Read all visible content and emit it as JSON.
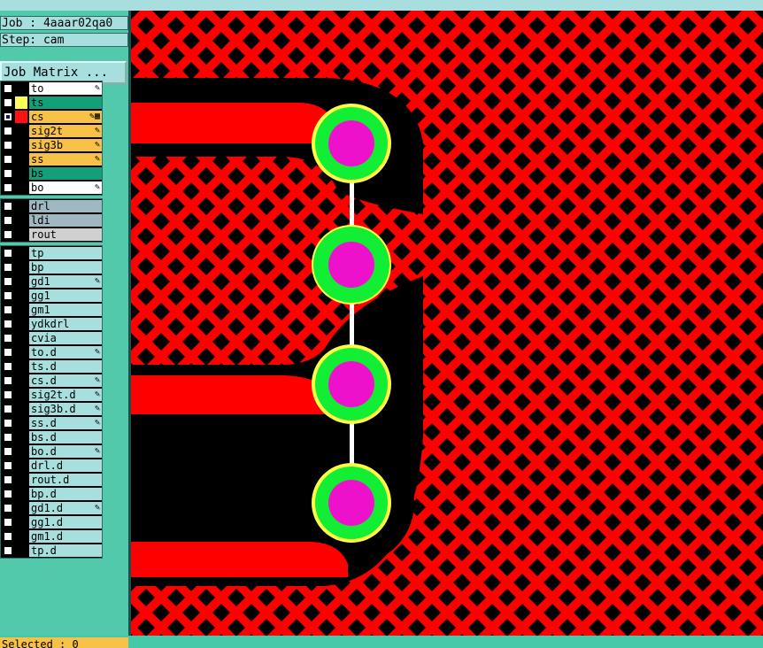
{
  "header": {
    "job": "Job : 4aaar02qa0",
    "step": "Step: cam",
    "job_matrix_label": "Job Matrix ..."
  },
  "board_layers": [
    {
      "name": "to",
      "color": "#ffffff",
      "swatch": "#000000",
      "edit": true,
      "active": false
    },
    {
      "name": "ts",
      "color": "#12a07a",
      "swatch": "#ffff55",
      "edit": false,
      "active": false
    },
    {
      "name": "cs",
      "color": "#f7c046",
      "swatch": "#ff1111",
      "edit": true,
      "active": true
    },
    {
      "name": "sig2t",
      "color": "#f7c046",
      "swatch": "#000000",
      "edit": true,
      "active": false
    },
    {
      "name": "sig3b",
      "color": "#f7c046",
      "swatch": "#000000",
      "edit": true,
      "active": false
    },
    {
      "name": "ss",
      "color": "#f7c046",
      "swatch": "#000000",
      "edit": true,
      "active": false
    },
    {
      "name": "bs",
      "color": "#12a07a",
      "swatch": "#000000",
      "edit": false,
      "active": false
    },
    {
      "name": "bo",
      "color": "#ffffff",
      "swatch": "#000000",
      "edit": true,
      "active": false
    }
  ],
  "drill_layers": [
    {
      "name": "drl",
      "color": "#9eb7c0",
      "swatch": "#000000",
      "edit": false,
      "active": false
    },
    {
      "name": "ldi",
      "color": "#9eb7c0",
      "swatch": "#000000",
      "edit": false,
      "active": false
    },
    {
      "name": "rout",
      "color": "#d0d0d0",
      "swatch": "#000000",
      "edit": false,
      "active": false
    }
  ],
  "misc_layers": [
    {
      "name": "tp",
      "color": "#a7dede",
      "swatch": "#000000",
      "edit": false,
      "active": false
    },
    {
      "name": "bp",
      "color": "#a7dede",
      "swatch": "#000000",
      "edit": false,
      "active": false
    },
    {
      "name": "gd1",
      "color": "#a7dede",
      "swatch": "#000000",
      "edit": true,
      "active": false
    },
    {
      "name": "gg1",
      "color": "#a7dede",
      "swatch": "#000000",
      "edit": false,
      "active": false
    },
    {
      "name": "gm1",
      "color": "#a7dede",
      "swatch": "#000000",
      "edit": false,
      "active": false
    },
    {
      "name": "ydkdrl",
      "color": "#a7dede",
      "swatch": "#000000",
      "edit": false,
      "active": false
    },
    {
      "name": "cvia",
      "color": "#a7dede",
      "swatch": "#000000",
      "edit": false,
      "active": false
    },
    {
      "name": "to.d",
      "color": "#a7dede",
      "swatch": "#000000",
      "edit": true,
      "active": false
    },
    {
      "name": "ts.d",
      "color": "#a7dede",
      "swatch": "#000000",
      "edit": false,
      "active": false
    },
    {
      "name": "cs.d",
      "color": "#a7dede",
      "swatch": "#000000",
      "edit": true,
      "active": false
    },
    {
      "name": "sig2t.d",
      "color": "#a7dede",
      "swatch": "#000000",
      "edit": true,
      "active": false
    },
    {
      "name": "sig3b.d",
      "color": "#a7dede",
      "swatch": "#000000",
      "edit": true,
      "active": false
    },
    {
      "name": "ss.d",
      "color": "#a7dede",
      "swatch": "#000000",
      "edit": true,
      "active": false
    },
    {
      "name": "bs.d",
      "color": "#a7dede",
      "swatch": "#000000",
      "edit": false,
      "active": false
    },
    {
      "name": "bo.d",
      "color": "#a7dede",
      "swatch": "#000000",
      "edit": true,
      "active": false
    },
    {
      "name": "drl.d",
      "color": "#a7dede",
      "swatch": "#000000",
      "edit": false,
      "active": false
    },
    {
      "name": "rout.d",
      "color": "#a7dede",
      "swatch": "#000000",
      "edit": false,
      "active": false
    },
    {
      "name": "bp.d",
      "color": "#a7dede",
      "swatch": "#000000",
      "edit": false,
      "active": false
    },
    {
      "name": "gd1.d",
      "color": "#a7dede",
      "swatch": "#000000",
      "edit": true,
      "active": false
    },
    {
      "name": "gg1.d",
      "color": "#a7dede",
      "swatch": "#000000",
      "edit": false,
      "active": false
    },
    {
      "name": "gm1.d",
      "color": "#a7dede",
      "swatch": "#000000",
      "edit": false,
      "active": false
    },
    {
      "name": "tp.d",
      "color": "#a7dede",
      "swatch": "#000000",
      "edit": false,
      "active": false
    }
  ],
  "status": {
    "selected": "Selected : 0"
  },
  "icons": {
    "edit": "pencil-icon",
    "active": "grid-icon"
  },
  "colors": {
    "copper": "#ff0000",
    "clearance": "#000000",
    "pad_outer": "#ffff44",
    "pad_ring": "#11ee33",
    "drill": "#ee11cc",
    "connector": "#ffffff"
  }
}
